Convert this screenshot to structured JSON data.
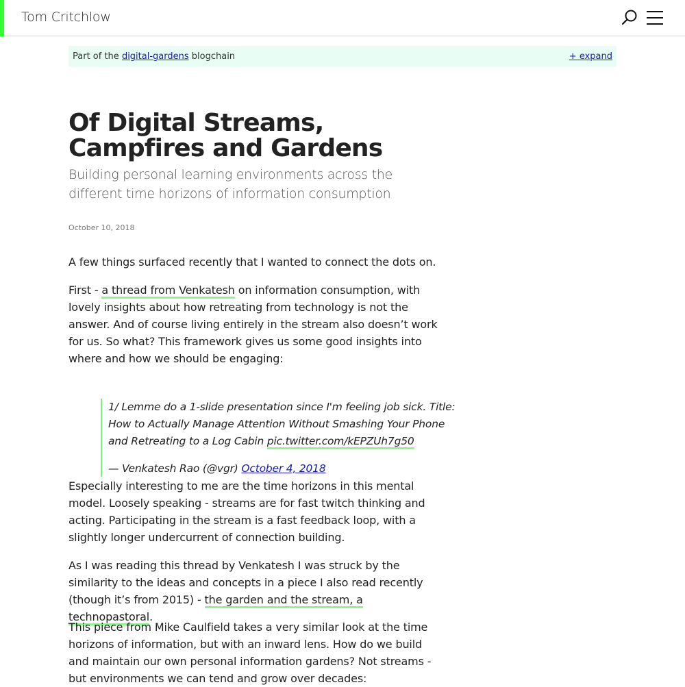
{
  "header": {
    "site_title": "Tom Critchlow",
    "accent_color": "#33ff33"
  },
  "blogchain": {
    "prefix": "Part of the ",
    "link": "digital-gardens",
    "suffix": " blogchain",
    "expand": "+ expand"
  },
  "article": {
    "title": "Of Digital Streams, Campfires and Gardens",
    "subtitle": "Building personal learning environments across the different time horizons of information consumption",
    "date": "October 10, 2018",
    "p1": "A few things surfaced recently that I wanted to connect the dots on.",
    "p2_pre": "First - ",
    "p2_link": "a thread from Venkatesh",
    "p2_post": " on information consumption, with lovely insights about how retreating from technology is not the answer. And of course living entirely in the stream also doesn’t work for us. So what? This framework gives us some good insights into where and how we should be engaging:",
    "quote_text": "1/ Lemme do a 1-slide presentation since I'm feeling job sick. Title: How to Actually Manage Attention Without Smashing Your Phone and Retreating to a Log Cabin ",
    "quote_link": "pic.twitter.com/kEPZUh7g50",
    "quote_attr": "— Venkatesh Rao (@vgr) ",
    "quote_date_link": "October 4, 2018",
    "p3": "Especially interesting to me are the time horizons in this mental model. Loosely speaking - streams are for fast twitch thinking and acting. Participating in the stream is a fast feedback loop, with a slightly longer undercurrent of connection building.",
    "p4_pre": "As I was reading this thread by Venkatesh I was struck by the similarity to the ideas and concepts in a piece I also read recently (though it’s from 2015) - ",
    "p4_link": "the garden and the stream, a technopastoral",
    "p4_post": ".",
    "p5": "This piece from Mike Caulfield takes a very similar look at the time horizons of information, but with an inward lens. How do we build and maintain our own personal information gardens? Not streams - but environments we can tend and grow over decades:"
  },
  "colors": {
    "link_underline": "#90f590",
    "blogchain_bg": "#e8fdf4",
    "link_blue": "#1a1ab0"
  }
}
